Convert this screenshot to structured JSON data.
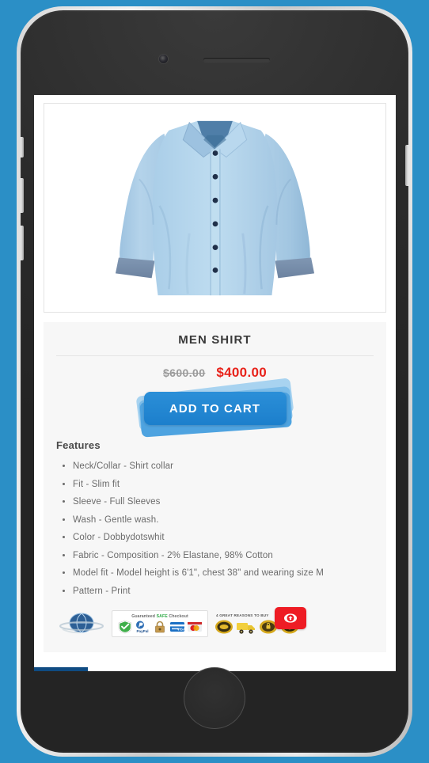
{
  "background": {
    "color": "#2b8fc6"
  },
  "device": {
    "name": "smartphone-mockup",
    "frame_color": "#2c2c2c",
    "bezel_color": "#d8d8d8",
    "camera": "camera-icon",
    "speaker": "speaker-grille",
    "home_button": "home-button",
    "side_buttons": [
      "silent-switch",
      "volume-up-button",
      "volume-down-button",
      "power-button"
    ]
  },
  "product": {
    "image_alt": "Light blue men's slim fit dress shirt",
    "title": "MEN SHIRT",
    "price_old": "$600.00",
    "price_new": "$400.00",
    "price_old_color": "#9b9b9b",
    "price_new_color": "#e8231b",
    "cta_label": "ADD TO CART",
    "cta_color": "#1c7fcc",
    "features_title": "Features",
    "features": [
      "Neck/Collar - Shirt collar",
      "Fit - Slim fit",
      "Sleeve - Full Sleeves",
      "Wash - Gentle wash.",
      "Color - Dobbydotswhit",
      "Fabric - Composition - 2% Elastane, 98% Cotton",
      "Model fit - Model height is 6'1\", chest 38\" and wearing size M",
      "Pattern - Print"
    ]
  },
  "badges": {
    "globe_label": "globe-trust-badge",
    "checkout": {
      "title_pre": "Guaranteed ",
      "title_safe": "SAFE",
      "title_post": " Checkout",
      "icons": [
        "mcafee-check-icon",
        "paypal-icon",
        "secure-lock-icon",
        "visa-card-icon",
        "mastercard-icon"
      ]
    },
    "reasons": {
      "title": "4 GREAT REASONS TO BUY",
      "icons": [
        "money-back-icon",
        "free-shipping-icon",
        "secure-payment-icon",
        "support-icon"
      ]
    },
    "red_badge": "secure-shield-badge"
  }
}
